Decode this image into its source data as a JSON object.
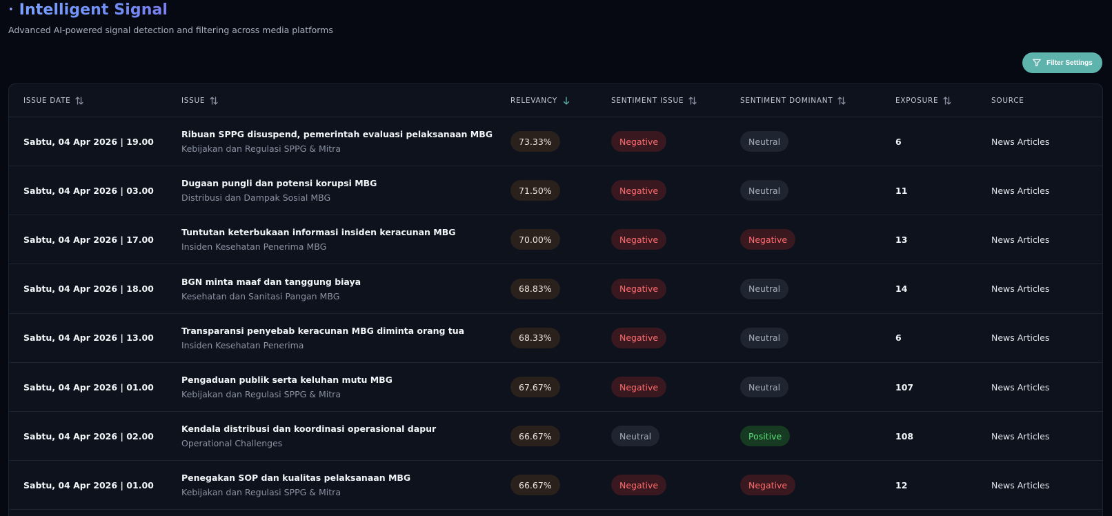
{
  "header": {
    "title": "Intelligent Signal",
    "subtitle": "Advanced AI-powered signal detection and filtering across media platforms",
    "filter_button": "Filter Settings"
  },
  "table": {
    "columns": [
      {
        "label": "ISSUE DATE",
        "sort": "both"
      },
      {
        "label": "ISSUE",
        "sort": "both"
      },
      {
        "label": "RELEVANCY",
        "sort": "desc"
      },
      {
        "label": "SENTIMENT ISSUE",
        "sort": "both"
      },
      {
        "label": "SENTIMENT DOMINANT",
        "sort": "both"
      },
      {
        "label": "EXPOSURE",
        "sort": "both"
      },
      {
        "label": "SOURCE",
        "sort": "none"
      }
    ],
    "rows": [
      {
        "date": "Sabtu, 04 Apr 2026 | 19.00",
        "title": "Ribuan SPPG disuspend, pemerintah evaluasi pelaksanaan MBG",
        "category": "Kebijakan dan Regulasi SPPG & Mitra",
        "relevancy": "73.33%",
        "sentiment_issue": "Negative",
        "sentiment_dominant": "Neutral",
        "exposure": "6",
        "source": "News Articles"
      },
      {
        "date": "Sabtu, 04 Apr 2026 | 03.00",
        "title": "Dugaan pungli dan potensi korupsi MBG",
        "category": "Distribusi dan Dampak Sosial MBG",
        "relevancy": "71.50%",
        "sentiment_issue": "Negative",
        "sentiment_dominant": "Neutral",
        "exposure": "11",
        "source": "News Articles"
      },
      {
        "date": "Sabtu, 04 Apr 2026 | 17.00",
        "title": "Tuntutan keterbukaan informasi insiden keracunan MBG",
        "category": "Insiden Kesehatan Penerima MBG",
        "relevancy": "70.00%",
        "sentiment_issue": "Negative",
        "sentiment_dominant": "Negative",
        "exposure": "13",
        "source": "News Articles"
      },
      {
        "date": "Sabtu, 04 Apr 2026 | 18.00",
        "title": "BGN minta maaf dan tanggung biaya",
        "category": "Kesehatan dan Sanitasi Pangan MBG",
        "relevancy": "68.83%",
        "sentiment_issue": "Negative",
        "sentiment_dominant": "Neutral",
        "exposure": "14",
        "source": "News Articles"
      },
      {
        "date": "Sabtu, 04 Apr 2026 | 13.00",
        "title": "Transparansi penyebab keracunan MBG diminta orang tua",
        "category": "Insiden Kesehatan Penerima",
        "relevancy": "68.33%",
        "sentiment_issue": "Negative",
        "sentiment_dominant": "Neutral",
        "exposure": "6",
        "source": "News Articles"
      },
      {
        "date": "Sabtu, 04 Apr 2026 | 01.00",
        "title": "Pengaduan publik serta keluhan mutu MBG",
        "category": "Kebijakan dan Regulasi SPPG & Mitra",
        "relevancy": "67.67%",
        "sentiment_issue": "Negative",
        "sentiment_dominant": "Neutral",
        "exposure": "107",
        "source": "News Articles"
      },
      {
        "date": "Sabtu, 04 Apr 2026 | 02.00",
        "title": "Kendala distribusi dan koordinasi operasional dapur",
        "category": "Operational Challenges",
        "relevancy": "66.67%",
        "sentiment_issue": "Neutral",
        "sentiment_dominant": "Positive",
        "exposure": "108",
        "source": "News Articles"
      },
      {
        "date": "Sabtu, 04 Apr 2026 | 01.00",
        "title": "Penegakan SOP dan kualitas pelaksanaan MBG",
        "category": "Kebijakan dan Regulasi SPPG & Mitra",
        "relevancy": "66.67%",
        "sentiment_issue": "Negative",
        "sentiment_dominant": "Negative",
        "exposure": "12",
        "source": "News Articles"
      }
    ]
  },
  "colors": {
    "accent": "#5fb3ad",
    "negative": "#ff6b6b",
    "positive": "#5fe07c",
    "neutral": "#a5adba",
    "title_gradient": "#7da2ff"
  }
}
